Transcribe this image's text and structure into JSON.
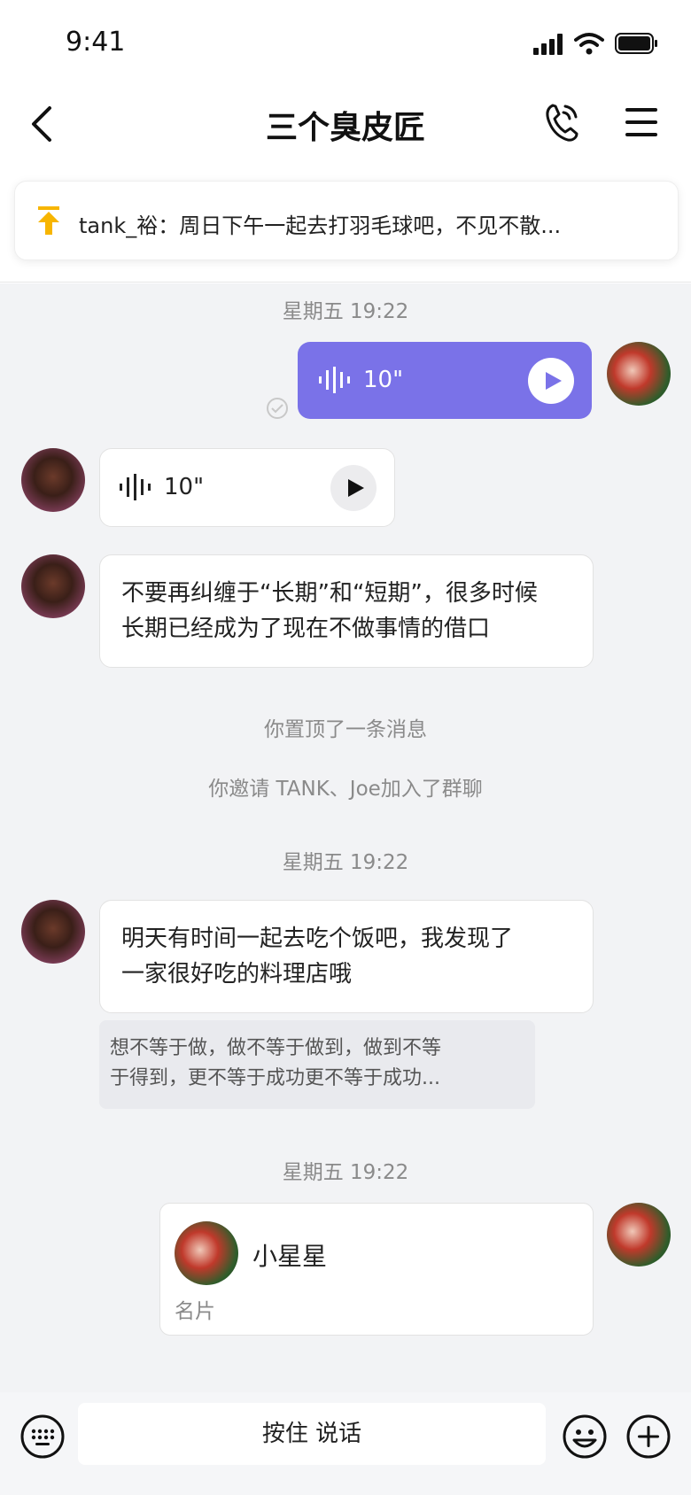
{
  "status_bar": {
    "time": "9:41"
  },
  "header": {
    "title": "三个臭皮匠"
  },
  "pinned": {
    "text": "tank_裕：周日下午一起去打羽毛球吧，不见不散..."
  },
  "timestamps": [
    "星期五 19:22",
    "星期五 19:22",
    "星期五 19:22"
  ],
  "messages": {
    "voice_me": {
      "duration": "10\""
    },
    "voice_other": {
      "duration": "10\""
    },
    "text_1": {
      "line1": "不要再纠缠于“长期”和“短期”，很多时候",
      "line2": "长期已经成为了现在不做事情的借口"
    },
    "text_2": {
      "line1": "明天有时间一起去吃个饭吧，我发现了",
      "line2": "一家很好吃的料理店哦"
    },
    "quote": {
      "line1": "想不等于做，做不等于做到，做到不等",
      "line2": "于得到，更不等于成功更不等于成功..."
    },
    "card": {
      "name": "小星星",
      "label": "名片"
    }
  },
  "system": {
    "pinned_notice": "你置顶了一条消息",
    "invite_notice": "你邀请 TANK、Joe加入了群聊"
  },
  "input": {
    "talk_label": "按住 说话"
  },
  "colors": {
    "accent": "#7a72e8",
    "pin": "#f7b500"
  }
}
